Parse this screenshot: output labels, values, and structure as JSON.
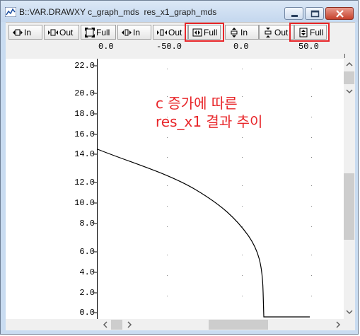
{
  "window": {
    "title": "B::VAR.DRAWXY c_graph_mds  res_x1_graph_mds"
  },
  "toolbar": {
    "buttons": [
      {
        "label": "In"
      },
      {
        "label": "Out"
      },
      {
        "label": "Full"
      },
      {
        "label": "In"
      },
      {
        "label": "Out"
      },
      {
        "label": "Full"
      },
      {
        "label": "In"
      },
      {
        "label": "Out"
      },
      {
        "label": "Full"
      }
    ]
  },
  "x_scale": {
    "labels": [
      "0.0",
      "-50.0",
      "0.0",
      "50.0"
    ]
  },
  "y_scale": {
    "labels": [
      "22.0",
      "20.0",
      "18.0",
      "16.0",
      "14.0",
      "12.0",
      "10.0",
      "8.0",
      "6.0",
      "4.0",
      "2.0",
      "0.0"
    ]
  },
  "annotation": {
    "line1": "c 증가에 따른",
    "line2": "res_x1 결과 추이"
  },
  "colors": {
    "highlight": "#e8262a",
    "annotation": "#e8262a"
  }
}
